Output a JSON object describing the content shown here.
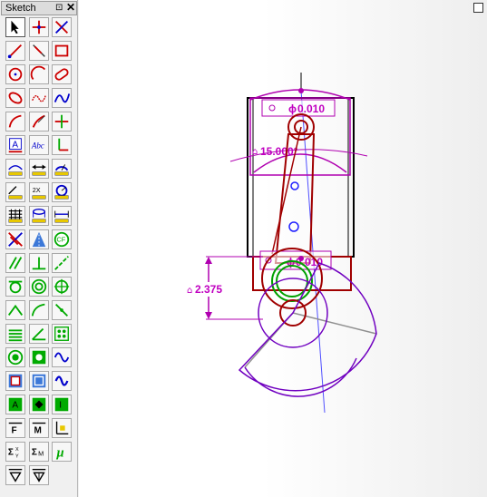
{
  "palette": {
    "title": "Sketch",
    "pin_glyph": "⊡",
    "close_glyph": "✕",
    "tools": [
      {
        "name": "select-arrow-icon",
        "label": ""
      },
      {
        "name": "point-icon",
        "label": ""
      },
      {
        "name": "delete-icon",
        "label": ""
      },
      {
        "name": "line-icon",
        "label": ""
      },
      {
        "name": "polyline-icon",
        "label": ""
      },
      {
        "name": "rectangle-icon",
        "label": ""
      },
      {
        "name": "circle-icon",
        "label": ""
      },
      {
        "name": "arc-icon",
        "label": ""
      },
      {
        "name": "slot-icon",
        "label": ""
      },
      {
        "name": "ellipse-icon",
        "label": ""
      },
      {
        "name": "spline-icon",
        "label": ""
      },
      {
        "name": "curve-icon",
        "label": ""
      },
      {
        "name": "tangent-arc-icon",
        "label": ""
      },
      {
        "name": "polyline-arc-icon",
        "label": ""
      },
      {
        "name": "construction-point-icon",
        "label": ""
      },
      {
        "name": "text-box-icon",
        "label": "A"
      },
      {
        "name": "text-icon",
        "label": "Abc"
      },
      {
        "name": "axis-icon",
        "label": ""
      },
      {
        "name": "arc-dimension-icon",
        "label": ""
      },
      {
        "name": "distance-dimension-icon",
        "label": ""
      },
      {
        "name": "angle-dimension-icon",
        "label": ""
      },
      {
        "name": "scale-dimension-icon",
        "label": ""
      },
      {
        "name": "double-dimension-icon",
        "label": "2X"
      },
      {
        "name": "radius-dimension-icon",
        "label": ""
      },
      {
        "name": "grid-icon",
        "label": ""
      },
      {
        "name": "cylinder-dimension-icon",
        "label": ""
      },
      {
        "name": "length-dimension-icon",
        "label": ""
      },
      {
        "name": "trim-icon",
        "label": ""
      },
      {
        "name": "path-icon",
        "label": ""
      },
      {
        "name": "cf-icon",
        "label": "CF"
      },
      {
        "name": "parallel-icon",
        "label": ""
      },
      {
        "name": "perpendicular-icon",
        "label": ""
      },
      {
        "name": "collinear-icon",
        "label": ""
      },
      {
        "name": "tangent-icon",
        "label": ""
      },
      {
        "name": "concentric-icon",
        "label": ""
      },
      {
        "name": "coincident-icon",
        "label": ""
      },
      {
        "name": "vertex-icon",
        "label": ""
      },
      {
        "name": "fillet-icon",
        "label": ""
      },
      {
        "name": "chamfer-icon",
        "label": ""
      },
      {
        "name": "horizontal-icon",
        "label": ""
      },
      {
        "name": "angle-icon",
        "label": ""
      },
      {
        "name": "pattern-icon",
        "label": ""
      },
      {
        "name": "fix-circle-icon",
        "label": ""
      },
      {
        "name": "fix-point-icon",
        "label": ""
      },
      {
        "name": "sine-icon",
        "label": ""
      },
      {
        "name": "face-offset-icon",
        "label": ""
      },
      {
        "name": "region-icon",
        "label": ""
      },
      {
        "name": "wave-icon",
        "label": ""
      },
      {
        "name": "apply-a-icon",
        "label": "A"
      },
      {
        "name": "apply-target-icon",
        "label": ""
      },
      {
        "name": "apply-i-icon",
        "label": "I"
      },
      {
        "name": "force-icon",
        "label": "F"
      },
      {
        "name": "moment-icon",
        "label": "M"
      },
      {
        "name": "coordinate-icon",
        "label": ""
      },
      {
        "name": "sum-forces-icon",
        "label": "ΣXY"
      },
      {
        "name": "sum-moments-icon",
        "label": "ΣM"
      },
      {
        "name": "friction-icon",
        "label": "μ"
      },
      {
        "name": "velocity-icon",
        "label": ""
      },
      {
        "name": "acceleration-icon",
        "label": ""
      }
    ]
  },
  "drawing": {
    "dim_top_tol": "0.010",
    "dim_mid_tol": "0.010",
    "dim_angle": "15.000°",
    "dim_length": "2.375",
    "diameter_symbol": "ϕ",
    "lock_symbol": "🔒",
    "colors": {
      "magenta": "#c000c0",
      "red": "#a00000",
      "blue": "#2020ff",
      "purple": "#7000c0",
      "green": "#00a000",
      "black": "#000000",
      "gray": "#909090"
    }
  }
}
